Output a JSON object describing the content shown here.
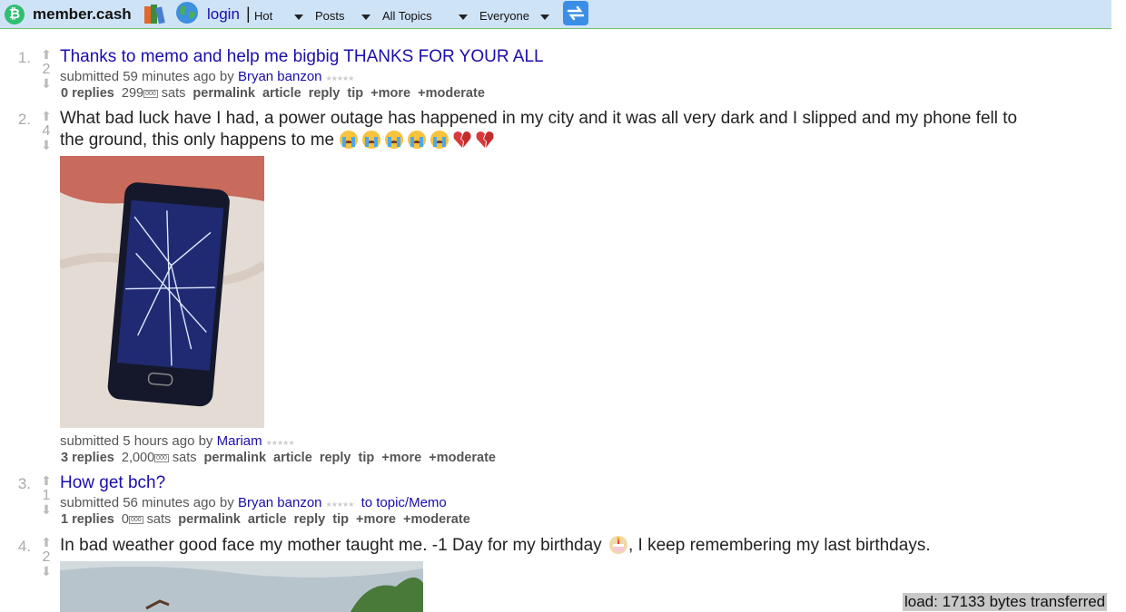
{
  "header": {
    "site_name": "member.cash",
    "login": "login",
    "separator": "|",
    "menus": [
      "Hot",
      "Posts",
      "All Topics",
      "Everyone"
    ]
  },
  "posts": [
    {
      "rank": "1.",
      "score": "2",
      "title": "Thanks to memo and help me bigbig THANKS FOR YOUR ALL",
      "submitted": "submitted 59 minutes ago by",
      "author": "Bryan banzon",
      "replies": "0 replies",
      "sats_value": "299",
      "sats_label": "sats"
    },
    {
      "rank": "2.",
      "score": "4",
      "title_line1": "What bad luck have I had, a power outage has happened in my city and it was all very dark and I slipped and my phone fell to",
      "title_line2": "the ground, this only happens to me",
      "submitted": "submitted 5 hours ago by",
      "author": "Mariam",
      "replies": "3 replies",
      "sats_value": "2,000",
      "sats_label": "sats"
    },
    {
      "rank": "3.",
      "score": "1",
      "title": "How get bch?",
      "submitted": "submitted 56 minutes ago by",
      "author": "Bryan banzon",
      "topic": "to topic/Memo",
      "replies": "1 replies",
      "sats_value": "0",
      "sats_label": "sats"
    },
    {
      "rank": "4.",
      "score": "2",
      "title_before": "In bad weather good face my mother taught me. -1 Day for my birthday",
      "title_after": ", I keep remembering my last birthdays."
    }
  ],
  "actions": [
    "permalink",
    "article",
    "reply",
    "tip",
    "+more",
    "+moderate"
  ],
  "unit_badge": "000",
  "footer": "load: 17133 bytes transferred",
  "colors": {
    "header_bg": "#cfe3f7",
    "link": "#1a0dab",
    "logo": "#2fbf71"
  },
  "icons": [
    "bitcoin-cash-logo-icon",
    "books-icon",
    "globe-icon",
    "refresh-icon",
    "crying-face-emoji",
    "broken-heart-emoji",
    "birthday-cake-emoji"
  ]
}
